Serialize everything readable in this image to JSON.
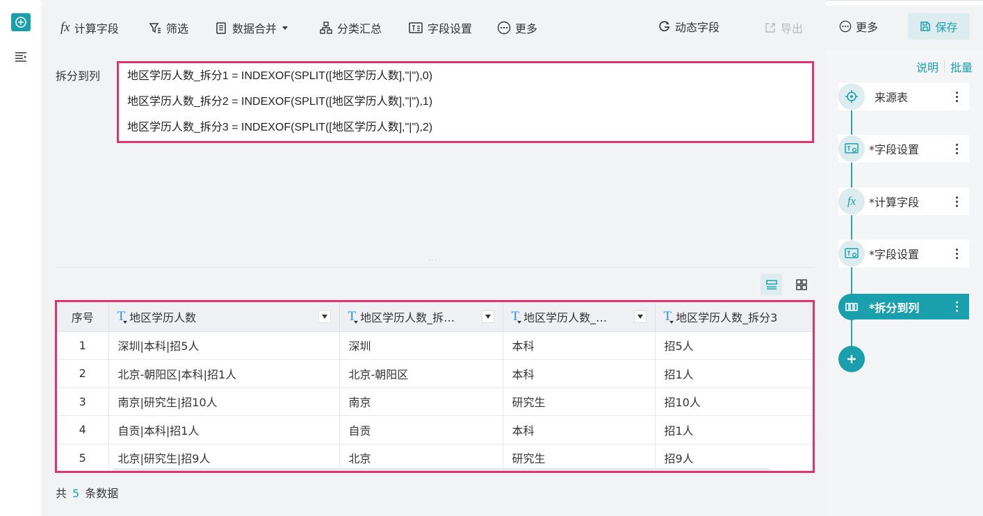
{
  "toolbar": {
    "calc_field": "计算字段",
    "filter": "筛选",
    "data_merge": "数据合并",
    "group_summary": "分类汇总",
    "field_settings": "字段设置",
    "more_left": "更多",
    "dynamic_field": "动态字段",
    "export": "导出",
    "more_right": "更多",
    "save": "保存"
  },
  "formula": {
    "label": "拆分到列",
    "lines": [
      "地区学历人数_拆分1 = INDEXOF(SPLIT([地区学历人数],\"|\"),0)",
      "地区学历人数_拆分2 = INDEXOF(SPLIT([地区学历人数],\"|\"),1)",
      "地区学历人数_拆分3 = INDEXOF(SPLIT([地区学历人数],\"|\"),2)"
    ],
    "dots": "..."
  },
  "table": {
    "columns": [
      "序号",
      "地区学历人数",
      "地区学历人数_拆…",
      "地区学历人数_…",
      "地区学历人数_拆分3"
    ],
    "rows": [
      [
        "1",
        "深圳|本科|招5人",
        "深圳",
        "本科",
        "招5人"
      ],
      [
        "2",
        "北京-朝阳区|本科|招1人",
        "北京-朝阳区",
        "本科",
        "招1人"
      ],
      [
        "3",
        "南京|研究生|招10人",
        "南京",
        "研究生",
        "招10人"
      ],
      [
        "4",
        "自贡|本科|招1人",
        "自贡",
        "本科",
        "招1人"
      ],
      [
        "5",
        "北京|研究生|招9人",
        "北京",
        "研究生",
        "招9人"
      ]
    ]
  },
  "footer": {
    "prefix": "共",
    "count": "5",
    "suffix": "条数据"
  },
  "side": {
    "explain": "说明",
    "batch": "批量",
    "steps": [
      {
        "label": "来源表",
        "icon": "source-icon"
      },
      {
        "label": "*字段设置",
        "icon": "field-settings-icon"
      },
      {
        "label": "*计算字段",
        "icon": "fx-icon"
      },
      {
        "label": "*字段设置",
        "icon": "field-settings-icon"
      },
      {
        "label": "*拆分到列",
        "icon": "split-columns-icon",
        "active": true
      }
    ]
  },
  "colors": {
    "accent": "#1aa0ac",
    "highlight": "#e0356c"
  }
}
